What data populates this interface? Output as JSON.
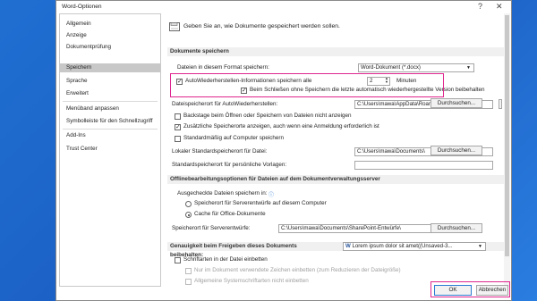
{
  "window": {
    "title": "Word-Optionen",
    "help": "?",
    "close": "✕"
  },
  "sidebar": {
    "items": [
      {
        "label": "Allgemein"
      },
      {
        "label": "Anzeige"
      },
      {
        "label": "Dokumentprüfung"
      },
      {
        "label": "Speichern",
        "selected": true
      },
      {
        "label": "Sprache"
      },
      {
        "label": "Erweitert"
      },
      {
        "label": "Menüband anpassen"
      },
      {
        "label": "Symbolleiste für den Schnellzugriff"
      },
      {
        "label": "Add-Ins"
      },
      {
        "label": "Trust Center"
      }
    ]
  },
  "header": {
    "text": "Geben Sie an, wie Dokumente gespeichert werden sollen."
  },
  "save_docs": {
    "section": "Dokumente speichern",
    "format_label": "Dateien in diesem Format speichern:",
    "format_value": "Word-Dokument (*.docx)",
    "autorecover_label": "AutoWiederherstellen-Informationen speichern alle",
    "autorecover_minutes": "2",
    "minutes_label": "Minuten",
    "keep_last_label": "Beim Schließen ohne Speichern die letzte automatisch wiederhergestellte Version beibehalten",
    "autorecover_path_label": "Dateispeicherort für AutoWiederherstellen:",
    "autorecover_path": "C:\\Users\\mawa\\AppData\\Roaming\\Microsoft\\Word\\",
    "browse": "Durchsuchen...",
    "backstage_label": "Backstage beim Öffnen oder Speichern von Dateien nicht anzeigen",
    "additional_places_label": "Zusätzliche Speicherorte anzeigen, auch wenn eine Anmeldung erforderlich ist",
    "default_computer_label": "Standardmäßig auf Computer speichern",
    "local_default_label": "Lokaler Standardspeicherort für Datei:",
    "local_default_path": "C:\\Users\\mawa\\Documents\\",
    "personal_templates_label": "Standardspeicherort für persönliche Vorlagen:",
    "personal_templates_path": ""
  },
  "offline": {
    "section": "Offlinebearbeitungsoptionen für Dateien auf dem Dokumentverwaltungsserver",
    "checked_out_label": "Ausgecheckte Dateien speichern in:",
    "radio1": "Speicherort für Serverentwürfe auf diesem Computer",
    "radio2": "Cache für Office-Dokumente",
    "drafts_label": "Speicherort für Serverentwürfe:",
    "drafts_path": "C:\\Users\\mawa\\Documents\\SharePoint-Entwürfe\\"
  },
  "fidelity": {
    "section": "Genauigkeit beim Freigeben dieses Dokuments beibehalten:",
    "document": "Lorem ipsum dolor sit amet((Unsaved-3...",
    "embed_fonts_label": "Schriftarten in der Datei einbetten",
    "embed_used_label": "Nur im Dokument verwendete Zeichen einbetten (zum Reduzieren der Dateigröße)",
    "no_common_label": "Allgemeine Systemschriftarten nicht einbetten"
  },
  "footer": {
    "ok": "OK",
    "cancel": "Abbrechen"
  },
  "colors": {
    "highlight": "#e0268f",
    "background": "#1f6fd1",
    "selected": "#c8c8c8"
  }
}
